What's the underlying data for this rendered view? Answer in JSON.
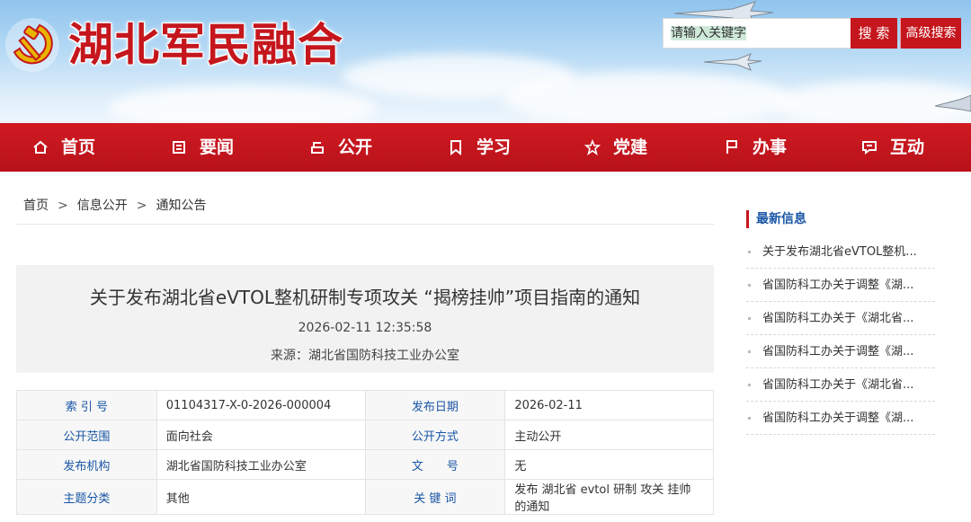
{
  "header": {
    "site_title": "湖北军民融合",
    "search_placeholder": "请输入关键字",
    "search_button": "搜 索",
    "advanced_search_button": "高级搜索"
  },
  "nav": {
    "items": [
      {
        "label": "首页",
        "icon": "home-icon"
      },
      {
        "label": "要闻",
        "icon": "news-icon"
      },
      {
        "label": "公开",
        "icon": "open-icon"
      },
      {
        "label": "学习",
        "icon": "bookmark-icon"
      },
      {
        "label": "党建",
        "icon": "star-icon"
      },
      {
        "label": "办事",
        "icon": "flag-icon"
      },
      {
        "label": "互动",
        "icon": "chat-icon"
      }
    ]
  },
  "breadcrumb": {
    "items": [
      "首页",
      "信息公开",
      "通知公告"
    ],
    "separator": ">"
  },
  "article": {
    "title": "关于发布湖北省eVTOL整机研制专项攻关 “揭榜挂帅”项目指南的通知",
    "date": "2026-02-11 12:35:58",
    "source": "来源：湖北省国防科技工业办公室"
  },
  "meta": {
    "rows": [
      {
        "k1": "索 引 号",
        "v1": "01104317-X-0-2026-000004",
        "k2": "发布日期",
        "v2": "2026-02-11"
      },
      {
        "k1": "公开范围",
        "v1": "面向社会",
        "k2": "公开方式",
        "v2": "主动公开"
      },
      {
        "k1": "发布机构",
        "v1": "湖北省国防科技工业办公室",
        "k2": "文　　号",
        "v2": "无"
      },
      {
        "k1": "主题分类",
        "v1": "其他",
        "k2": "关 键 词",
        "v2": "发布 湖北省 evtol 研制 攻关 挂帅 的通知"
      }
    ]
  },
  "sidebar": {
    "title": "最新信息",
    "items": [
      "关于发布湖北省eVTOL整机...",
      "省国防科工办关于调整《湖...",
      "省国防科工办关于《湖北省...",
      "省国防科工办关于调整《湖...",
      "省国防科工办关于《湖北省...",
      "省国防科工办关于调整《湖..."
    ]
  },
  "colors": {
    "brand_red": "#c5161d",
    "link_blue": "#1a56a6"
  }
}
